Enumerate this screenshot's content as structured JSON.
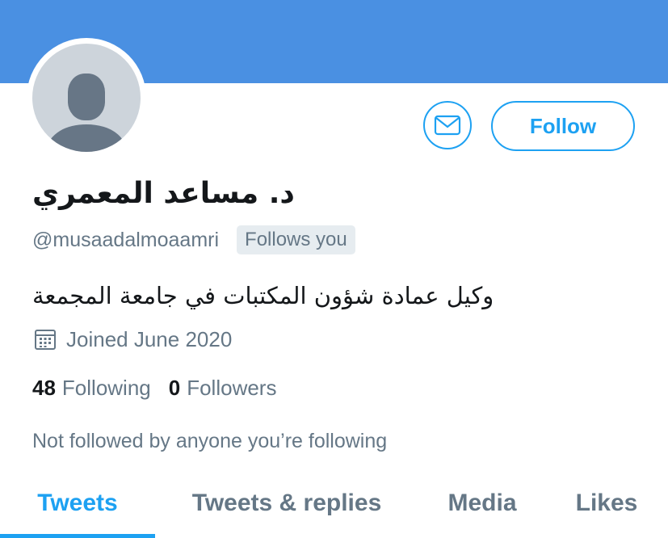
{
  "colors": {
    "banner": "#4a90e2",
    "accent": "#1da1f2",
    "text_primary": "#14171a",
    "text_secondary": "#657786",
    "badge_bg": "#e6ecf0",
    "avatar_bg": "#cdd4db",
    "avatar_figure": "#677686"
  },
  "icons": {
    "message": "envelope-icon",
    "joined": "calendar-icon",
    "avatar": "default-profile-silhouette"
  },
  "profile": {
    "display_name": "د. مساعد المعمري",
    "handle": "@musaadalmoaamri",
    "follows_you_badge": "Follows you",
    "bio": "وكيل عمادة شؤون المكتبات في جامعة المجمعة",
    "joined": "Joined June 2020",
    "following_count": "48",
    "following_label": "Following",
    "followers_count": "0",
    "followers_label": "Followers",
    "not_followed_text": "Not followed by anyone you’re following"
  },
  "actions": {
    "follow_label": "Follow"
  },
  "tabs": [
    {
      "label": "Tweets",
      "active": true
    },
    {
      "label": "Tweets & replies",
      "active": false
    },
    {
      "label": "Media",
      "active": false
    },
    {
      "label": "Likes",
      "active": false
    }
  ]
}
